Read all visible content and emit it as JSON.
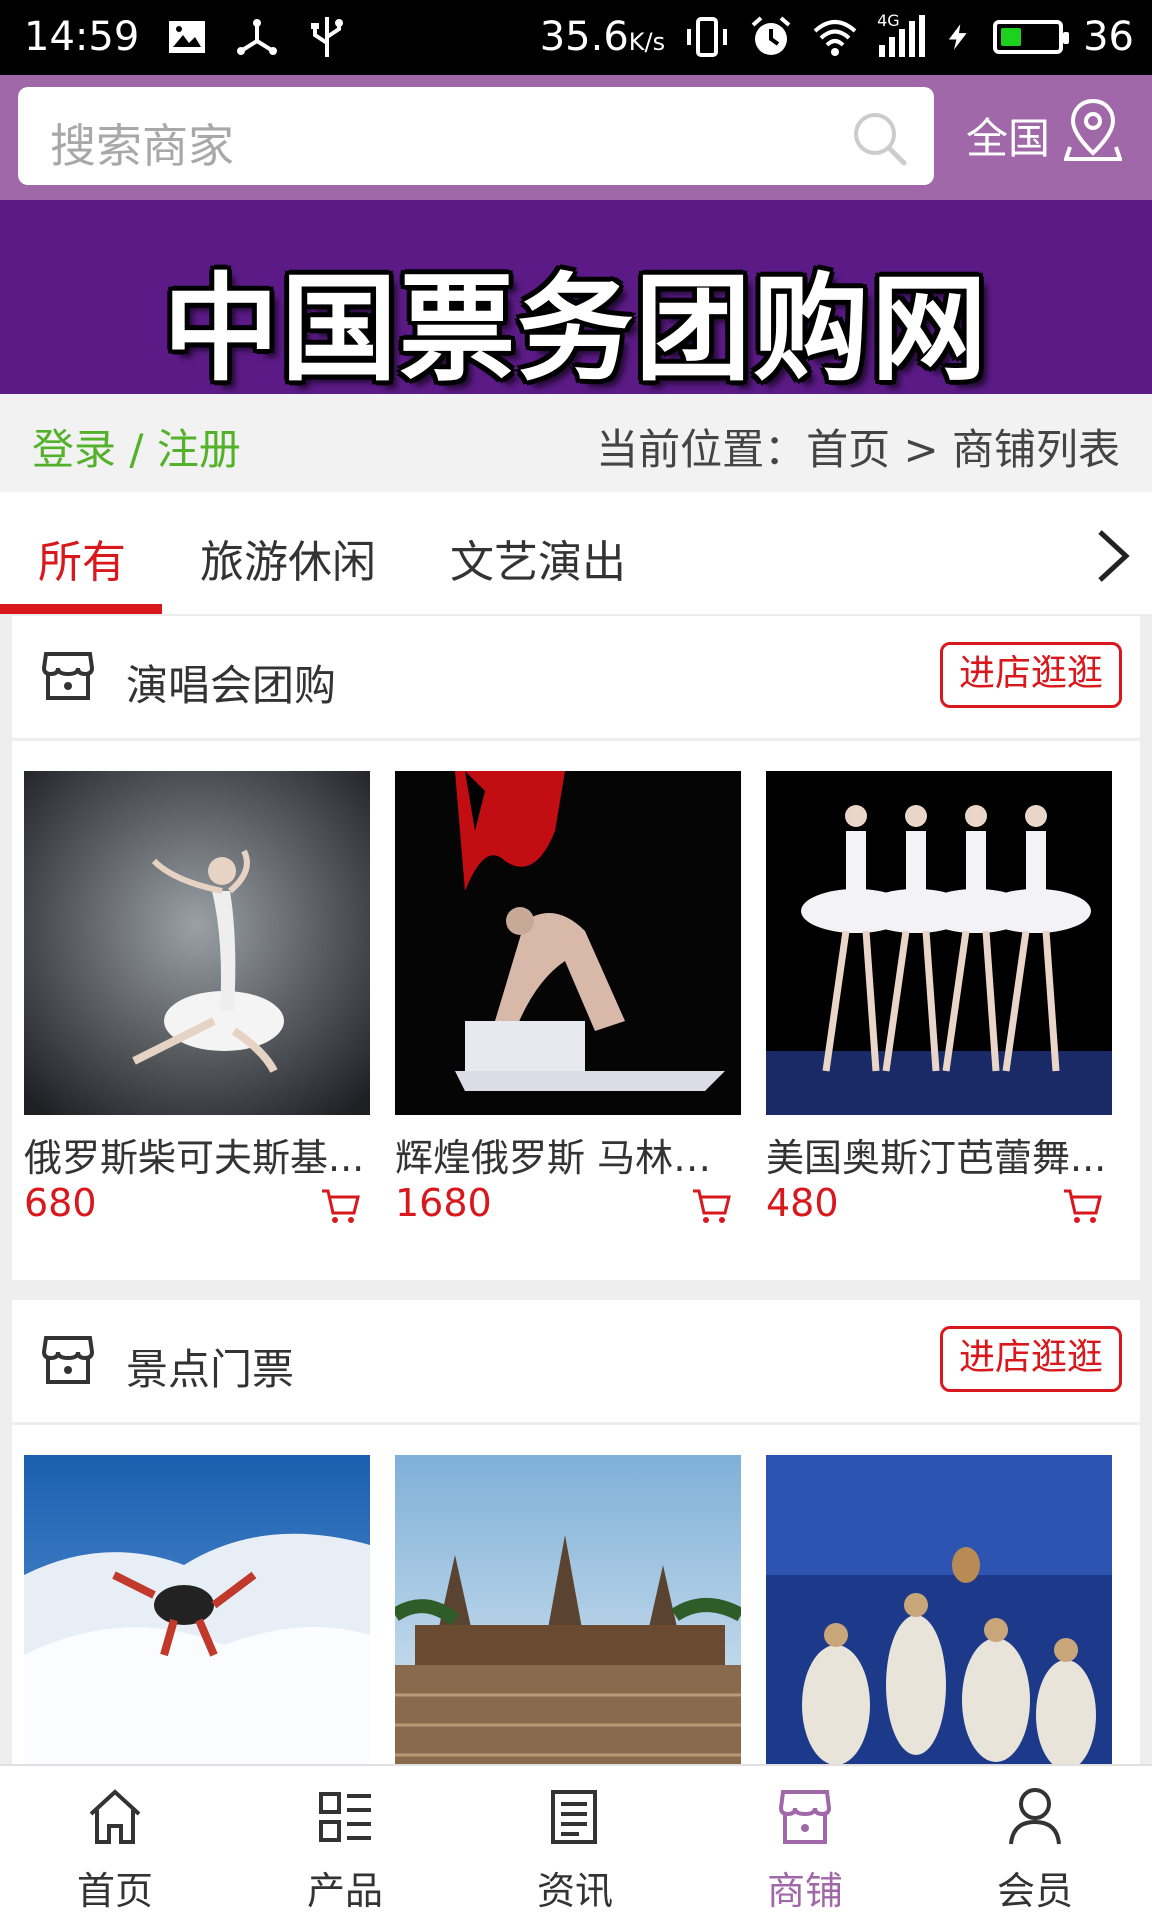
{
  "status_bar": {
    "time": "14:59",
    "speed": "35.6",
    "speed_unit": "K/s",
    "battery_level": "36",
    "network_label": "4G",
    "battery_fill": 0.36,
    "icons": [
      "image-icon",
      "usb-tether-icon",
      "usb-icon",
      "vibrate-icon",
      "alarm-icon",
      "wifi-icon",
      "signal-icon",
      "charging-icon",
      "battery-icon"
    ]
  },
  "search": {
    "placeholder": "搜索商家",
    "region": "全国"
  },
  "banner": {
    "title": "中国票务团购网"
  },
  "breadcrumb": {
    "login_register": "登录 / 注册",
    "location": "当前位置：首页 > 商铺列表"
  },
  "tabs": [
    {
      "label": "所有",
      "active": true
    },
    {
      "label": "旅游休闲",
      "active": false
    },
    {
      "label": "文艺演出",
      "active": false
    }
  ],
  "shops": [
    {
      "name": "演唱会团购",
      "button": "进店逛逛",
      "products": [
        {
          "name": "俄罗斯柴可夫斯基...",
          "price": "680"
        },
        {
          "name": "辉煌俄罗斯 马林斯...",
          "price": "1680"
        },
        {
          "name": "美国奥斯汀芭蕾舞...",
          "price": "480"
        }
      ]
    },
    {
      "name": "景点门票",
      "button": "进店逛逛",
      "products": [
        {
          "name": "",
          "price": ""
        },
        {
          "name": "",
          "price": ""
        },
        {
          "name": "",
          "price": ""
        }
      ]
    }
  ],
  "bottom_nav": [
    {
      "label": "首页",
      "icon": "home-icon",
      "active": false
    },
    {
      "label": "产品",
      "icon": "product-list-icon",
      "active": false
    },
    {
      "label": "资讯",
      "icon": "news-icon",
      "active": false
    },
    {
      "label": "商铺",
      "icon": "shop-icon",
      "active": true
    },
    {
      "label": "会员",
      "icon": "user-icon",
      "active": false
    }
  ],
  "colors": {
    "header_purple": "#a168a9",
    "banner_purple": "#5b1a86",
    "accent_red": "#d8181d",
    "login_green": "#53b12a"
  }
}
